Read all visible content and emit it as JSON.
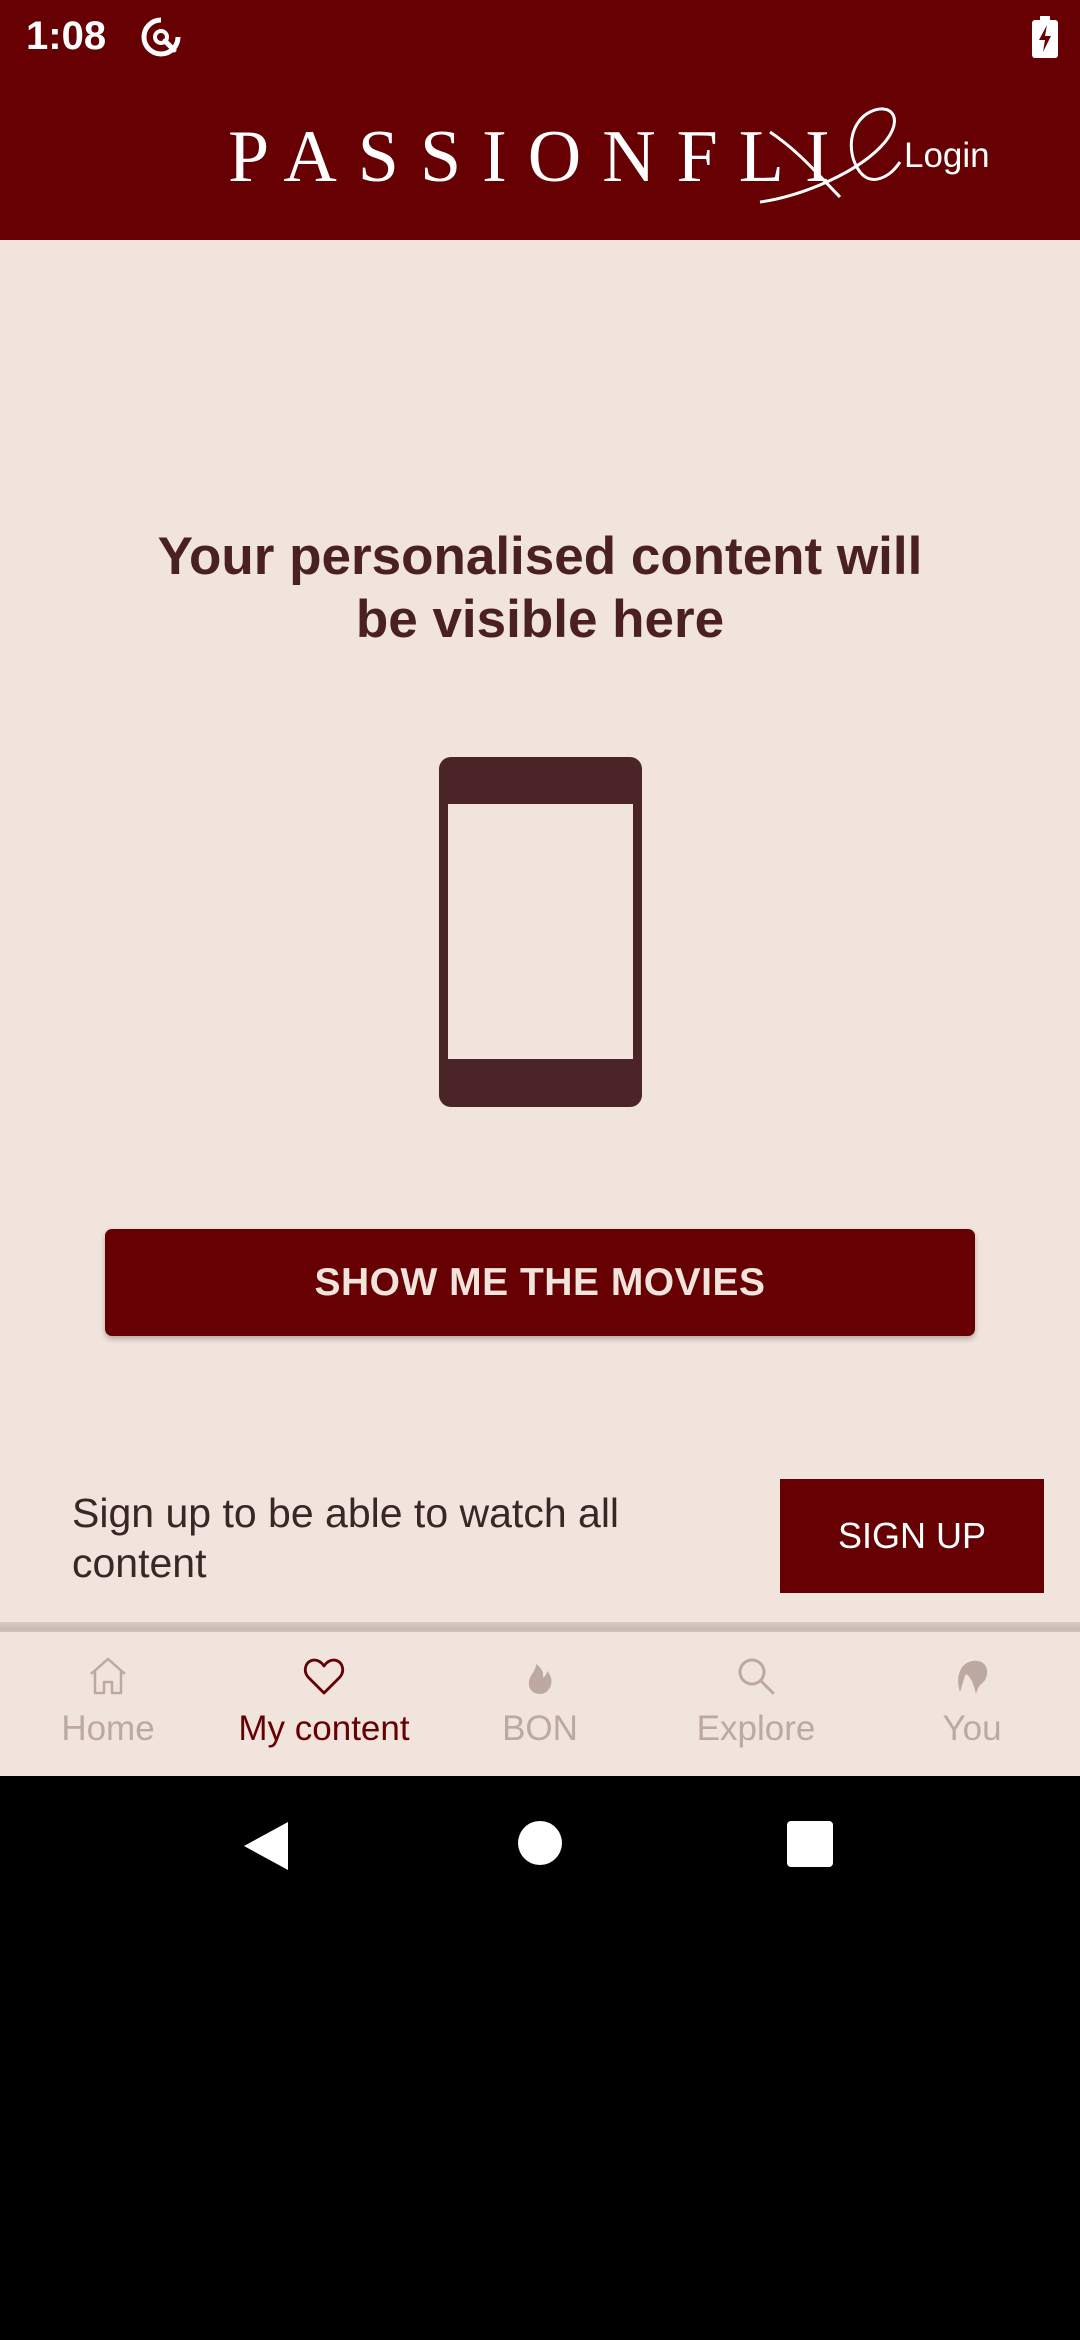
{
  "status_bar": {
    "time": "1:08",
    "icons": [
      "sync-icon",
      "battery-charging-icon"
    ]
  },
  "header": {
    "logo_text": "PASSIONFLI",
    "login_label": "Login"
  },
  "main": {
    "headline": "Your personalised content will be visible here",
    "illustration": "phone-icon",
    "cta_label": "SHOW ME THE MOVIES",
    "signup_text": "Sign up to be able to watch all content",
    "signup_label": "SIGN UP"
  },
  "bottom_nav": {
    "active_index": 1,
    "items": [
      {
        "label": "Home",
        "icon": "home-icon"
      },
      {
        "label": "My content",
        "icon": "heart-icon"
      },
      {
        "label": "BON",
        "icon": "flame-icon"
      },
      {
        "label": "Explore",
        "icon": "search-icon"
      },
      {
        "label": "You",
        "icon": "profile-icon"
      }
    ]
  },
  "colors": {
    "brand": "#660003",
    "background": "#f0e4dc",
    "text_dark": "#4a2022",
    "inactive": "#bda9a1"
  }
}
